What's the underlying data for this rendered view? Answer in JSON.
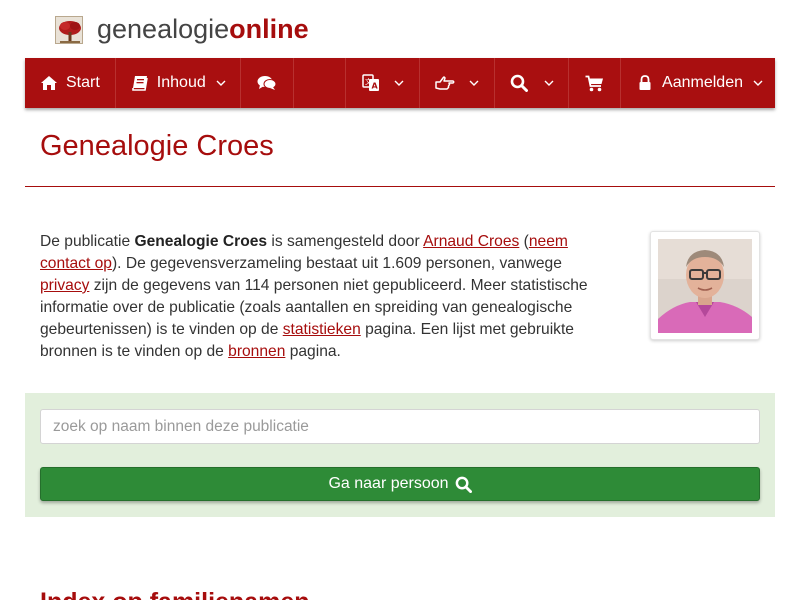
{
  "logo": {
    "text_plain": "genealogie",
    "text_bold": "online",
    "brand_color": "#a60d0d"
  },
  "navbar": {
    "background": "#a90f10",
    "items": [
      {
        "label": "Start",
        "icon": "home-icon",
        "has_dropdown": false
      },
      {
        "label": "Inhoud",
        "icon": "book-icon",
        "has_dropdown": true
      },
      {
        "label": "",
        "icon": "comments-icon",
        "has_dropdown": false
      },
      {
        "label": "",
        "icon": "language-icon",
        "has_dropdown": true
      },
      {
        "label": "",
        "icon": "hand-pointer-icon",
        "has_dropdown": true
      },
      {
        "label": "",
        "icon": "search-icon",
        "has_dropdown": true
      },
      {
        "label": "",
        "icon": "shopping-cart-icon",
        "has_dropdown": false
      },
      {
        "label": "Aanmelden",
        "icon": "lock-icon",
        "has_dropdown": true
      }
    ]
  },
  "page": {
    "title": "Genealogie Croes"
  },
  "intro": {
    "t1": "De publicatie ",
    "bold_name": "Genealogie Croes",
    "t2": " is samengesteld door ",
    "author_link": "Arnaud Croes",
    "t3": "(",
    "contact_link": "neem contact op",
    "t4": "). De gegevensverzameling bestaat uit 1.609 personen, vanwege ",
    "privacy_link": "privacy",
    "t5": " zijn de gegevens van 114 personen niet gepubliceerd. Meer statistische informatie over de publicatie (zoals aantallen en spreiding van genealogische gebeurtenissen) is te vinden op de ",
    "stats_link": "statistieken",
    "t6": " pagina. Een lijst met gebruikte bronnen is te vinden op de ",
    "sources_link": "bronnen",
    "t7": " pagina."
  },
  "search": {
    "placeholder": "zoek op naam binnen deze publicatie",
    "value": "",
    "button_label": "Ga naar persoon",
    "button_icon": "search-icon",
    "panel_color": "#e2efdc",
    "button_color": "#2e8b37"
  },
  "section": {
    "heading": "Index op familienamen"
  }
}
